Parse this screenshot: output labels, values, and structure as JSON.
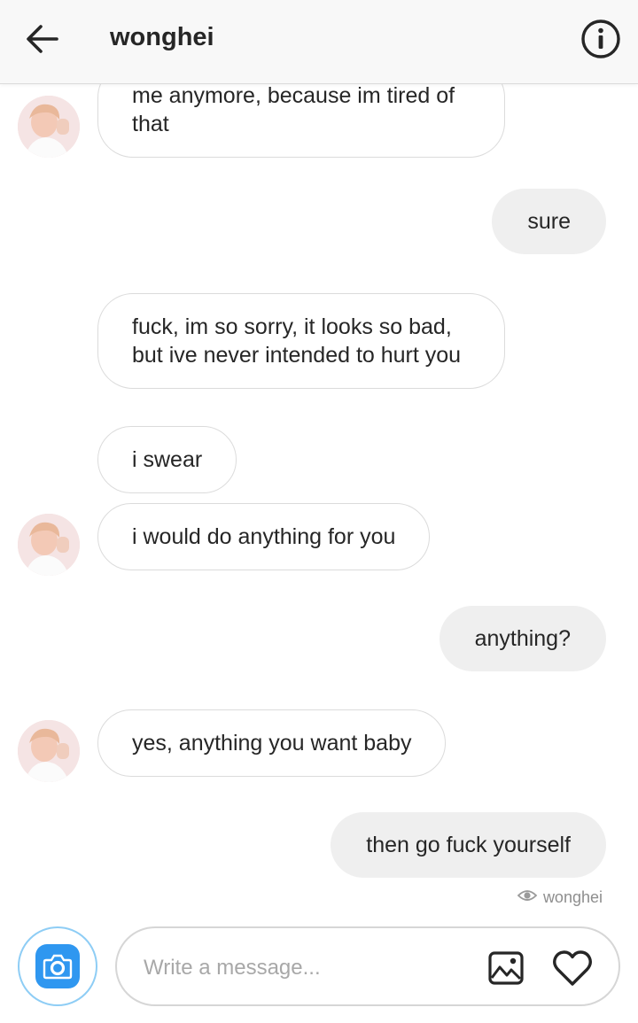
{
  "header": {
    "title": "wonghei",
    "back_icon": "back-arrow-icon",
    "info_icon": "info-icon"
  },
  "thread": {
    "messages": [
      {
        "direction": "in",
        "text": "me anymore, because im tired of that",
        "avatar": true
      },
      {
        "direction": "out",
        "text": "sure"
      },
      {
        "direction": "in",
        "text": "fuck, im so sorry, it looks so bad, but ive never intended to hurt you",
        "avatar": false
      },
      {
        "direction": "in",
        "text": "i swear",
        "avatar": false
      },
      {
        "direction": "in",
        "text": "i would do anything for you",
        "avatar": true
      },
      {
        "direction": "out",
        "text": "anything?"
      },
      {
        "direction": "in",
        "text": "yes, anything you want baby",
        "avatar": true
      },
      {
        "direction": "out",
        "text": "then go fuck yourself"
      }
    ],
    "seen_by": "wonghei",
    "seen_icon": "seen-eye-icon"
  },
  "composer": {
    "placeholder": "Write a message...",
    "value": "",
    "camera_icon": "camera-icon",
    "gallery_icon": "gallery-icon",
    "heart_icon": "heart-icon"
  },
  "colors": {
    "header_bg": "#f8f8f8",
    "outgoing_bubble": "#efefef",
    "incoming_border": "#dbdbdb",
    "camera_blue": "#2f97f0",
    "text": "#262626",
    "muted": "#8e8e8e"
  }
}
